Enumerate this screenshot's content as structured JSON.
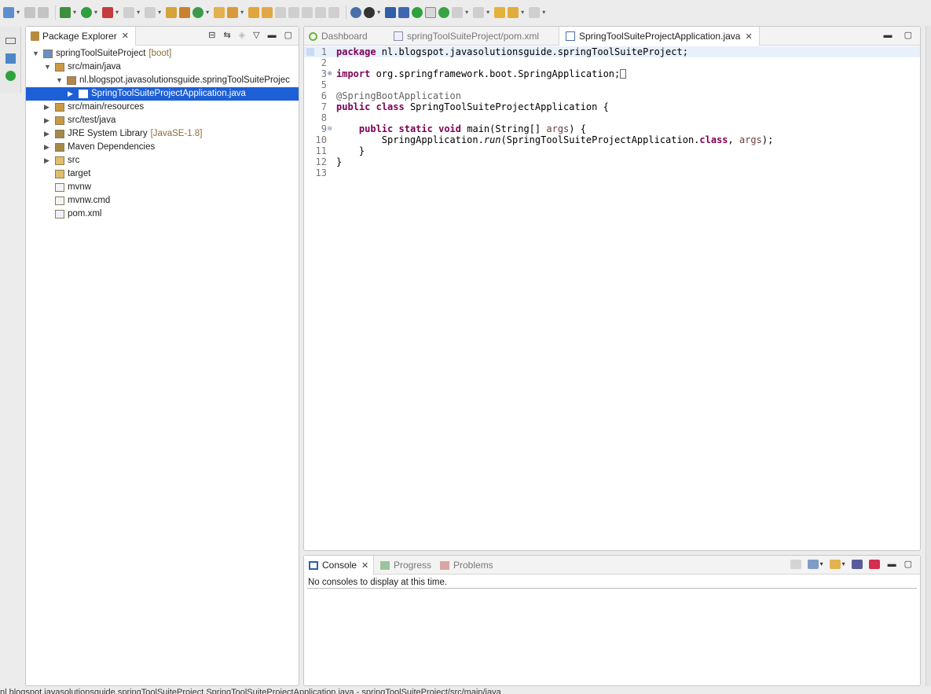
{
  "toolbar": {
    "icons": [
      "new-icon",
      "save-icon",
      "save-all-icon",
      "debug-icon",
      "run-icon",
      "run-coverage-icon",
      "stop-icon",
      "external-tools-icon",
      "new-java-project-icon",
      "new-package-icon",
      "new-class-icon",
      "open-type-icon",
      "open-task-icon",
      "search-icon",
      "spring-icon",
      "globe-icon",
      "boot-dashboard-icon",
      "console-icon",
      "pin-icon",
      "power-icon",
      "toggle-mark-icon",
      "refresh-icon",
      "next-annotation-icon",
      "prev-annotation-icon",
      "last-edit-icon",
      "back-icon",
      "forward-icon"
    ]
  },
  "package_explorer": {
    "title": "Package Explorer",
    "tree": [
      {
        "label": "springToolSuiteProject",
        "decoration": "[boot]",
        "icon": "project-icon",
        "expanded": true,
        "level": 0
      },
      {
        "label": "src/main/java",
        "decoration": "",
        "icon": "source-folder-icon",
        "expanded": true,
        "level": 1
      },
      {
        "label": "nl.blogspot.javasolutionsguide.springToolSuiteProjec",
        "decoration": "",
        "icon": "package-icon",
        "expanded": true,
        "level": 2
      },
      {
        "label": "SpringToolSuiteProjectApplication.java",
        "decoration": "",
        "icon": "java-file-icon",
        "expanded": false,
        "level": 3,
        "selected": true
      },
      {
        "label": "src/main/resources",
        "decoration": "",
        "icon": "source-folder-icon",
        "expanded": false,
        "level": 1
      },
      {
        "label": "src/test/java",
        "decoration": "",
        "icon": "source-folder-icon",
        "expanded": false,
        "level": 1
      },
      {
        "label": "JRE System Library",
        "decoration": "[JavaSE-1.8]",
        "icon": "library-icon",
        "expanded": false,
        "level": 1
      },
      {
        "label": "Maven Dependencies",
        "decoration": "",
        "icon": "library-icon",
        "expanded": false,
        "level": 1
      },
      {
        "label": "src",
        "decoration": "",
        "icon": "folder-icon",
        "expanded": false,
        "level": 1
      },
      {
        "label": "target",
        "decoration": "",
        "icon": "folder-icon",
        "expanded": null,
        "level": 1
      },
      {
        "label": "mvnw",
        "decoration": "",
        "icon": "file-icon",
        "expanded": null,
        "level": 1
      },
      {
        "label": "mvnw.cmd",
        "decoration": "",
        "icon": "file-icon",
        "expanded": null,
        "level": 1
      },
      {
        "label": "pom.xml",
        "decoration": "",
        "icon": "maven-file-icon",
        "expanded": null,
        "level": 1
      }
    ]
  },
  "editor": {
    "tabs": [
      {
        "label": "Dashboard",
        "active": false
      },
      {
        "label": "springToolSuiteProject/pom.xml",
        "active": false
      },
      {
        "label": "SpringToolSuiteProjectApplication.java",
        "active": true
      }
    ],
    "lines": [
      {
        "num": "1",
        "fold": "",
        "text": "package nl.blogspot.javasolutionsguide.springToolSuiteProject;"
      },
      {
        "num": "2",
        "fold": "",
        "text": ""
      },
      {
        "num": "3",
        "fold": "⊕",
        "text": "import org.springframework.boot.SpringApplication;"
      },
      {
        "num": "5",
        "fold": "",
        "text": ""
      },
      {
        "num": "6",
        "fold": "",
        "text": "@SpringBootApplication"
      },
      {
        "num": "7",
        "fold": "",
        "text": "public class SpringToolSuiteProjectApplication {"
      },
      {
        "num": "8",
        "fold": "",
        "text": ""
      },
      {
        "num": "9",
        "fold": "⊖",
        "text": "    public static void main(String[] args) {"
      },
      {
        "num": "10",
        "fold": "",
        "text": "        SpringApplication.run(SpringToolSuiteProjectApplication.class, args);"
      },
      {
        "num": "11",
        "fold": "",
        "text": "    }"
      },
      {
        "num": "12",
        "fold": "",
        "text": "}"
      },
      {
        "num": "13",
        "fold": "",
        "text": ""
      }
    ]
  },
  "console_panel": {
    "tabs": [
      {
        "label": "Console",
        "active": true
      },
      {
        "label": "Progress",
        "active": false
      },
      {
        "label": "Problems",
        "active": false
      }
    ],
    "message": "No consoles to display at this time."
  },
  "status_bar": {
    "text": "nl.blogspot.javasolutionsguide.springToolSuiteProject.SpringToolSuiteProjectApplication.java - springToolSuiteProject/src/main/java"
  },
  "colors": {
    "selection": "#1d5fd6",
    "keyword": "#7f0055",
    "annotation": "#646464"
  }
}
